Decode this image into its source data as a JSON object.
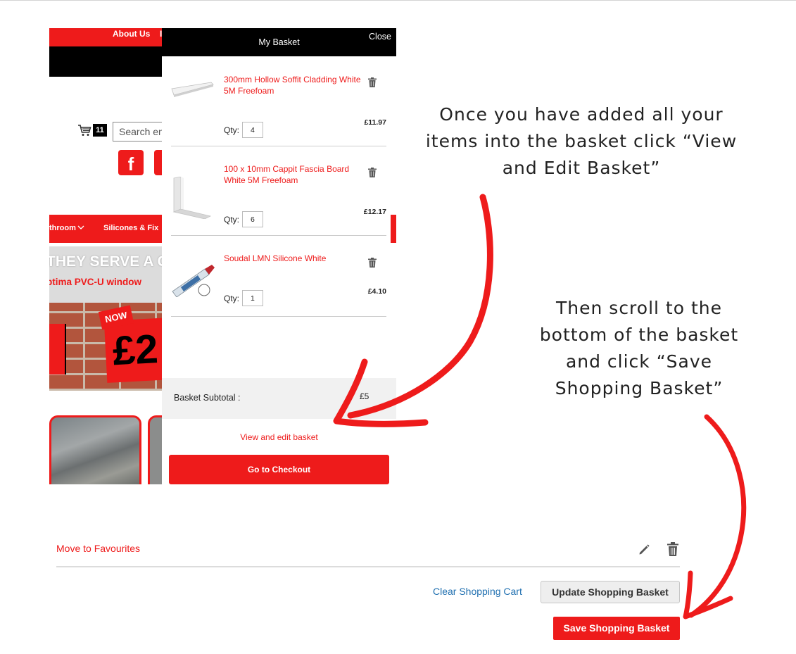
{
  "site": {
    "topbar_link": "About Us",
    "topbar_sep": "I",
    "cart_count": "11",
    "search_placeholder": "Search en",
    "social_fb": "f",
    "nav_item_1": "throom",
    "nav_item_2": "Silicones & Fix",
    "banner_heading": "THEY SERVE A G",
    "banner_sub": "ptima PVC-U window",
    "promo_now": "NOW",
    "promo_price": "£2"
  },
  "basket": {
    "title": "My Basket",
    "close": "Close",
    "items": [
      {
        "name": "300mm Hollow Soffit Cladding White 5M Freefoam",
        "qty_label": "Qty:",
        "qty": "4",
        "price": "£11.97"
      },
      {
        "name": "100 x 10mm Cappit Fascia Board White 5M Freefoam",
        "qty_label": "Qty:",
        "qty": "6",
        "price": "£12.17"
      },
      {
        "name": "Soudal LMN Silicone White",
        "qty_label": "Qty:",
        "qty": "1",
        "price": "£4.10"
      }
    ],
    "subtotal_label": "Basket Subtotal :",
    "subtotal_value": "£5",
    "view_edit": "View and edit basket",
    "checkout": "Go to Checkout"
  },
  "instructions": {
    "step1": "Once you have added all your items into the basket click “View and Edit Basket”",
    "step2": "Then scroll to the bottom of the basket and click “Save Shopping Basket”"
  },
  "cart_page": {
    "move_to_favourites": "Move to Favourites",
    "clear_cart": "Clear Shopping Cart",
    "update_basket": "Update Shopping Basket",
    "save_basket": "Save Shopping Basket"
  },
  "colors": {
    "brand_red": "#ee1b1b",
    "link_blue": "#1f6fb0",
    "header_black": "#000000"
  }
}
